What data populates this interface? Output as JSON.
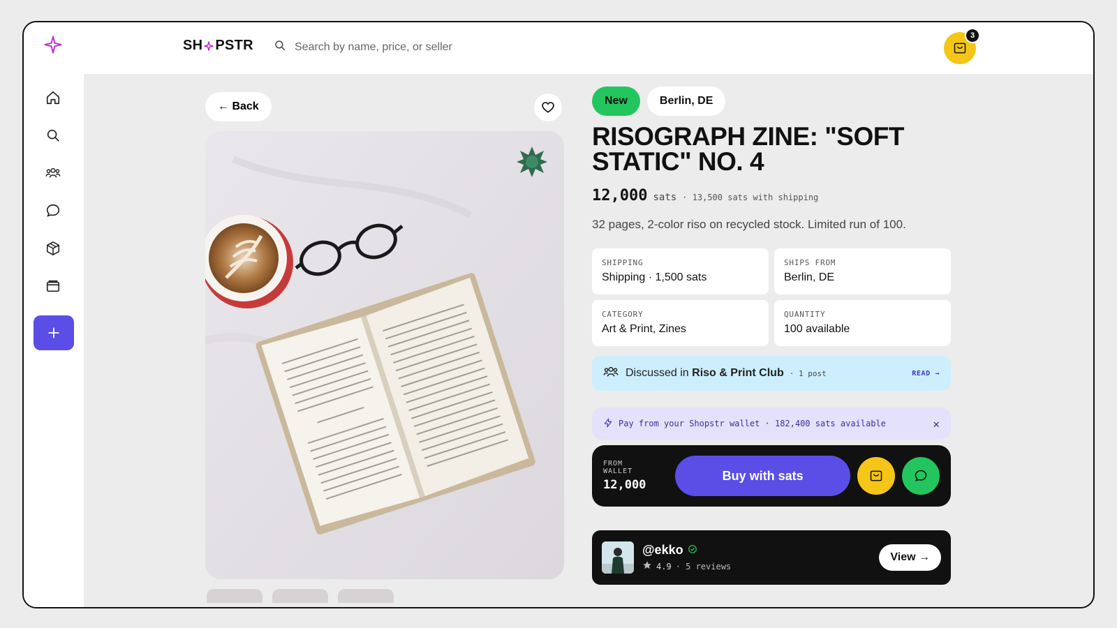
{
  "brand": {
    "left": "SH",
    "right": "PSTR"
  },
  "search": {
    "placeholder": "Search by name, price, or seller"
  },
  "cart": {
    "count": "3"
  },
  "nav": {
    "back_label": "← Back"
  },
  "product": {
    "condition": "New",
    "location": "Berlin, DE",
    "title": "RISOGRAPH ZINE: \"SOFT STATIC\" NO. 4",
    "price": "12,000",
    "price_unit": "sats",
    "price_shipping": "· 13,500 sats with shipping",
    "description": "32 pages, 2-color riso on recycled stock. Limited run of 100.",
    "details": [
      {
        "label": "SHIPPING",
        "value": "Shipping · 1,500 sats"
      },
      {
        "label": "SHIPS FROM",
        "value": "Berlin, DE"
      },
      {
        "label": "CATEGORY",
        "value": "Art & Print, Zines"
      },
      {
        "label": "QUANTITY",
        "value": "100 available"
      }
    ]
  },
  "discussion": {
    "prefix": "Discussed in",
    "club": "Riso & Print Club",
    "posts": "· 1 post",
    "read": "READ →"
  },
  "wallet": {
    "text": "Pay from your Shopstr wallet · 182,400 sats available",
    "close": "✕"
  },
  "buy": {
    "from_label": "FROM WALLET",
    "from_value": "12,000",
    "button": "Buy with sats"
  },
  "seller": {
    "handle": "@ekko",
    "rating": "4.9",
    "reviews": "· 5 reviews",
    "view": "View →"
  },
  "colors": {
    "accent": "#5b4ee6",
    "yellow": "#f5c518",
    "green": "#22c55e",
    "dark": "#111111"
  }
}
